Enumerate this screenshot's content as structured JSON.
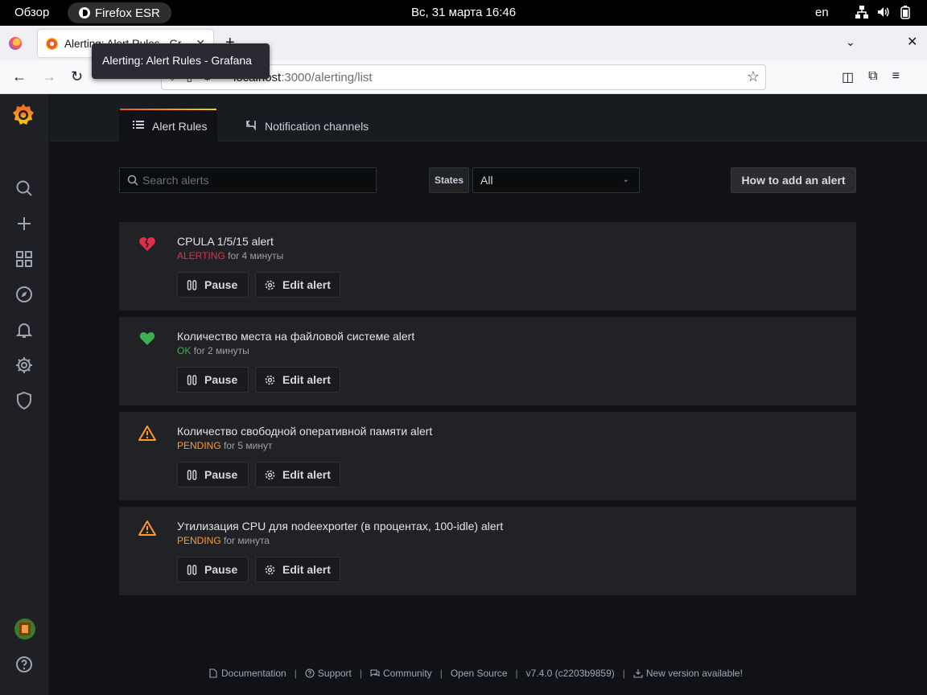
{
  "os": {
    "overview_label": "Обзор",
    "app_label": "Firefox ESR",
    "clock": "Вс, 31 марта  16:46",
    "language": "en"
  },
  "browser": {
    "tab_title": "Alerting: Alert Rules - Gr",
    "tooltip": "Alerting: Alert Rules - Grafana",
    "url_host": "localhost",
    "url_path": ":3000/alerting/list"
  },
  "header": {
    "tabs": [
      {
        "label": "Alert Rules",
        "active": true
      },
      {
        "label": "Notification channels",
        "active": false
      }
    ]
  },
  "toolbar": {
    "search_placeholder": "Search alerts",
    "search_value": "",
    "states_label": "States",
    "states_value": "All",
    "add_button": "How to add an alert"
  },
  "alerts": [
    {
      "title": "CPULA 1/5/15 alert",
      "state": "ALERTING",
      "duration": "for 4 минуты",
      "icon": "heart-break-icon"
    },
    {
      "title": "Количество места на файловой системе alert",
      "state": "OK",
      "duration": "for 2 минуты",
      "icon": "heart-icon"
    },
    {
      "title": "Количество свободной оперативной памяти alert",
      "state": "PENDING",
      "duration": "for 5 минут",
      "icon": "warning-icon"
    },
    {
      "title": "Утилизация CPU для nodeexporter (в процентах, 100-idle) alert",
      "state": "PENDING",
      "duration": "for минута",
      "icon": "warning-icon"
    }
  ],
  "buttons": {
    "pause": "Pause",
    "edit": "Edit alert"
  },
  "footer": {
    "documentation": "Documentation",
    "support": "Support",
    "community": "Community",
    "open_source": "Open Source",
    "version": "v7.4.0 (c2203b9859)",
    "new_version": "New version available!"
  },
  "colors": {
    "alerting": "#e02f44",
    "ok": "#3fae55",
    "pending": "#ff9830",
    "accent": "#f05a28"
  }
}
